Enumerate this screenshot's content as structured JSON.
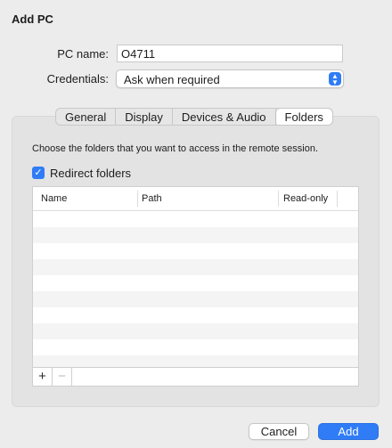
{
  "dialog": {
    "title": "Add PC"
  },
  "form": {
    "pc_name_label": "PC name:",
    "pc_name_value": "O4711",
    "credentials_label": "Credentials:",
    "credentials_value": "Ask when required"
  },
  "tabs": [
    {
      "label": "General"
    },
    {
      "label": "Display"
    },
    {
      "label": "Devices & Audio"
    },
    {
      "label": "Folders",
      "active": true
    }
  ],
  "folders": {
    "instruction": "Choose the folders that you want to access in the remote session.",
    "redirect_label": "Redirect folders",
    "redirect_checked": true,
    "columns": {
      "name": "Name",
      "path": "Path",
      "readonly": "Read-only"
    },
    "add_symbol": "+",
    "remove_symbol": "−"
  },
  "buttons": {
    "cancel": "Cancel",
    "add": "Add"
  },
  "colors": {
    "accent": "#2f7cf6",
    "background": "#ececec"
  }
}
